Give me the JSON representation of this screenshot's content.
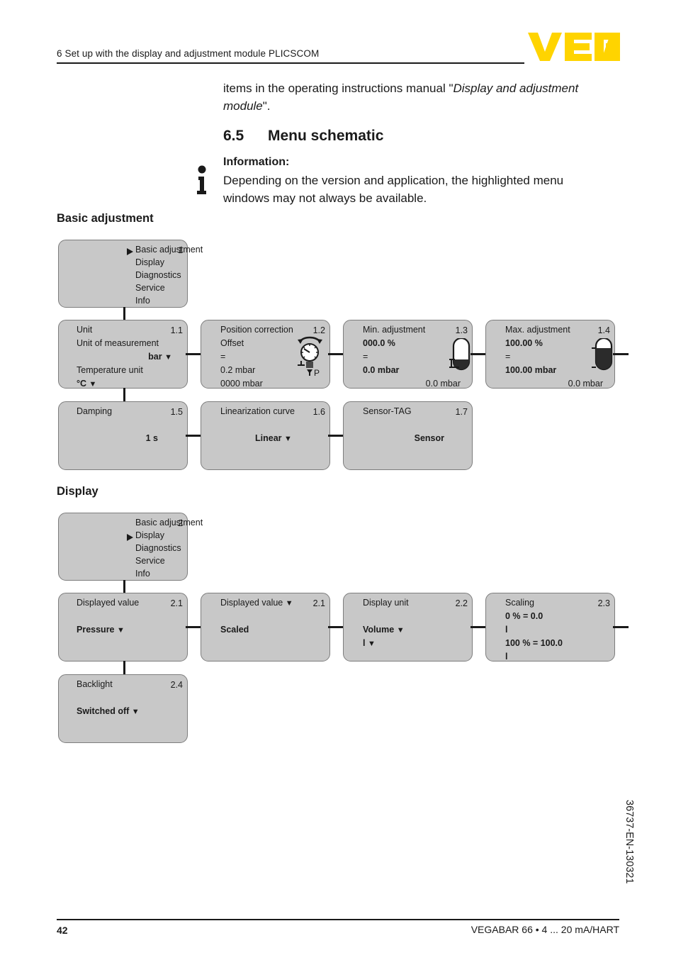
{
  "header": {
    "chapter": "6 Set up with the display and adjustment module PLICSCOM",
    "logo_text": "VEGA",
    "logo_color": "#FFD400"
  },
  "intro": {
    "text_part1": "items in the operating instructions manual \"",
    "text_italic": "Display and adjustment module",
    "text_part2": "\"."
  },
  "section": {
    "number": "6.5",
    "title": "Menu schematic"
  },
  "info": {
    "heading": "Information:",
    "body": "Depending on the version and application, the highlighted menu windows may not always be available."
  },
  "groups": {
    "basic": {
      "heading": "Basic adjustment"
    },
    "display": {
      "heading": "Display"
    }
  },
  "boxes": {
    "basic_root": {
      "num": "1",
      "lines": [
        "Basic adjustment",
        "Display",
        "Diagnostics",
        "Service",
        "Info"
      ],
      "selected_index": 0
    },
    "unit": {
      "num": "1.1",
      "title": "Unit",
      "l1": "Unit of measurement",
      "l2": "bar",
      "l3": "Temperature unit",
      "l4": "°C"
    },
    "position_correction": {
      "num": "1.2",
      "title": "Position correction",
      "l1": "Offset",
      "l2": "=",
      "l3": "0.2 mbar",
      "l4": "0000 mbar",
      "icon": "pressure-gauge-icon",
      "icon_label_bottom": "P"
    },
    "min_adjustment": {
      "num": "1.3",
      "title": "Min. adjustment",
      "l1": "000.0 %",
      "l2": "=",
      "l3": "0.0 mbar",
      "l4": "0.0 mbar",
      "icon": "tank-level-min-icon"
    },
    "max_adjustment": {
      "num": "1.4",
      "title": "Max. adjustment",
      "l1": "100.00 %",
      "l2": "=",
      "l3": "100.00 mbar",
      "l4": "0.0 mbar",
      "icon": "tank-level-max-icon"
    },
    "damping": {
      "num": "1.5",
      "title": "Damping",
      "value": "1 s"
    },
    "linearization": {
      "num": "1.6",
      "title": "Linearization curve",
      "value": "Linear"
    },
    "sensor_tag": {
      "num": "1.7",
      "title": "Sensor-TAG",
      "value": "Sensor"
    },
    "display_root": {
      "num": "2",
      "lines": [
        "Basic adjustment",
        "Display",
        "Diagnostics",
        "Service",
        "Info"
      ],
      "selected_index": 1
    },
    "displayed_value_1": {
      "num": "2.1",
      "title": "Displayed value",
      "value": "Pressure"
    },
    "displayed_value_2": {
      "num": "2.1",
      "title": "Displayed value",
      "value": "Scaled"
    },
    "display_unit": {
      "num": "2.2",
      "title": "Display unit",
      "l1": "Volume",
      "l2": "l"
    },
    "scaling": {
      "num": "2.3",
      "title": "Scaling",
      "l1": "0 % = 0.0",
      "l2": "l",
      "l3": "100 % = 100.0",
      "l4": "l"
    },
    "backlight": {
      "num": "2.4",
      "title": "Backlight",
      "value": "Switched off"
    }
  },
  "footer": {
    "page": "42",
    "product": "VEGABAR 66 • 4 ... 20 mA/HART",
    "doc_code": "36737-EN-130321"
  }
}
